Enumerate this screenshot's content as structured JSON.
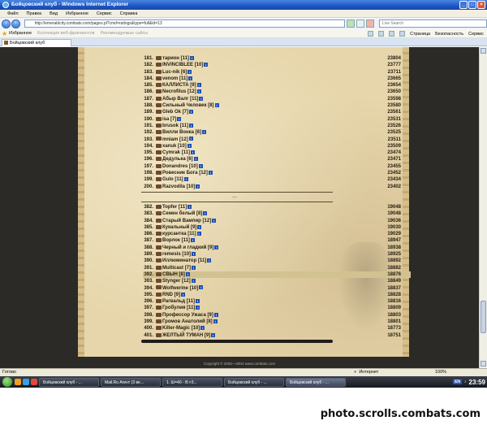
{
  "window": {
    "title": "Бойцовский клуб - Windows Internet Explorer"
  },
  "menu": [
    "Файл",
    "Правка",
    "Вид",
    "Избранное",
    "Сервис",
    "Справка"
  ],
  "address": {
    "url": "http://emeraldcity.combats.com/pages.pl?cmd=ratings&type=full&id=13",
    "search_placeholder": "Live Search"
  },
  "favorites": {
    "label": "Избранное",
    "items": [
      "Коллекция веб-фрагментов",
      "Рекомендуемые сайты"
    ],
    "commands": [
      "Страница",
      "Безопасность",
      "Сервис"
    ]
  },
  "tab": {
    "label": "Бойцовский клуб"
  },
  "ratings_top": [
    {
      "rank": "181.",
      "name": "тарион",
      "level": "[11]",
      "score": "23804"
    },
    {
      "rank": "182.",
      "name": "INVINCIBLEE",
      "level": "[10]",
      "score": "23777"
    },
    {
      "rank": "183.",
      "name": "Luc-nik",
      "level": "[6]",
      "score": "23711"
    },
    {
      "rank": "184.",
      "name": "venom",
      "level": "[11]",
      "score": "23665"
    },
    {
      "rank": "185.",
      "name": "КАЛЛИСТА",
      "level": "[9]",
      "score": "23654"
    },
    {
      "rank": "186.",
      "name": "Necrofilus",
      "level": "[12]",
      "score": "23650"
    },
    {
      "rank": "187.",
      "name": "Абыр Валг",
      "level": "[11]",
      "score": "23598"
    },
    {
      "rank": "188.",
      "name": "Сильный Человек",
      "level": "[8]",
      "score": "23580"
    },
    {
      "rank": "189.",
      "name": "Gleb Ok",
      "level": "[7]",
      "score": "23561"
    },
    {
      "rank": "190.",
      "name": "isa",
      "level": "[7]",
      "score": "23531"
    },
    {
      "rank": "191.",
      "name": "brusok",
      "level": "[11]",
      "score": "23526"
    },
    {
      "rank": "192.",
      "name": "Вилли Вонка",
      "level": "[8]",
      "score": "23525"
    },
    {
      "rank": "193.",
      "name": "mniam",
      "level": "[12]",
      "score": "23511"
    },
    {
      "rank": "194.",
      "name": "xanuk",
      "level": "[10]",
      "score": "23509"
    },
    {
      "rank": "195.",
      "name": "Cymrak",
      "level": "[11]",
      "score": "23474"
    },
    {
      "rank": "196.",
      "name": "Дедулька",
      "level": "[6]",
      "score": "23471"
    },
    {
      "rank": "197.",
      "name": "Donandres",
      "level": "[10]",
      "score": "23455"
    },
    {
      "rank": "198.",
      "name": "Ровесник Бога",
      "level": "[12]",
      "score": "23452"
    },
    {
      "rank": "199.",
      "name": "Gulo",
      "level": "[11]",
      "score": "23434"
    },
    {
      "rank": "200.",
      "name": "Razvodila",
      "level": "[10]",
      "score": "23402"
    }
  ],
  "ellipsis": "...",
  "ratings_bottom": [
    {
      "rank": "382.",
      "name": "Topfer",
      "level": "[11]",
      "score": "19048"
    },
    {
      "rank": "383.",
      "name": "Семен белый",
      "level": "[8]",
      "score": "19048"
    },
    {
      "rank": "384.",
      "name": "Старый Вампир",
      "level": "[12]",
      "score": "19036"
    },
    {
      "rank": "385.",
      "name": "Кукальный",
      "level": "[9]",
      "score": "19030"
    },
    {
      "rank": "386.",
      "name": "курсантка",
      "level": "[11]",
      "score": "19029"
    },
    {
      "rank": "387.",
      "name": "Ворлок",
      "level": "[11]",
      "score": "18947"
    },
    {
      "rank": "388.",
      "name": "Черный и гладкий",
      "level": "[9]",
      "score": "18938"
    },
    {
      "rank": "389.",
      "name": "remesis",
      "level": "[10]",
      "score": "18925"
    },
    {
      "rank": "390.",
      "name": "Иллюминатор",
      "level": "[11]",
      "score": "18892"
    },
    {
      "rank": "391.",
      "name": "Multicast",
      "level": "[7]",
      "score": "18882"
    },
    {
      "rank": "392.",
      "name": "СВЫН",
      "level": "[8]",
      "score": "18876"
    },
    {
      "rank": "393.",
      "name": "Stynger",
      "level": "[12]",
      "score": "18849"
    },
    {
      "rank": "394.",
      "name": "Wolfwerine",
      "level": "[10]",
      "score": "18837"
    },
    {
      "rank": "395.",
      "name": "RND",
      "level": "[9]",
      "score": "18828"
    },
    {
      "rank": "396.",
      "name": "Рагвальд",
      "level": "[11]",
      "score": "18816"
    },
    {
      "rank": "397.",
      "name": "Гробулия",
      "level": "[11]",
      "score": "18809"
    },
    {
      "rank": "398.",
      "name": "Профессор Ужаса",
      "level": "[9]",
      "score": "18803"
    },
    {
      "rank": "399.",
      "name": "Громов Анатолий",
      "level": "[8]",
      "score": "18801"
    },
    {
      "rank": "400.",
      "name": "Killer-Magic",
      "level": "[10]",
      "score": "18773"
    },
    {
      "rank": "401.",
      "name": "ЖЕЛТЫЙ ТУМАН",
      "level": "[9]",
      "score": "18751"
    }
  ],
  "footer": {
    "copyright": "Copyright © 2002—2004 www.combats.com"
  },
  "status": {
    "text": "Готово",
    "zone": "Интернет",
    "zoom": "100%"
  },
  "taskbar": {
    "tasks": [
      "Бойцовский клуб - ...",
      "Mail.Ru Агент (3 ве...",
      "1. Ш=40 - В:>3...",
      "Бойцовский клуб - ...",
      "Бойцовский клуб - ..."
    ],
    "lang": "EN",
    "time": "23:59"
  },
  "watermark": "photo.scrolls.combats.com"
}
